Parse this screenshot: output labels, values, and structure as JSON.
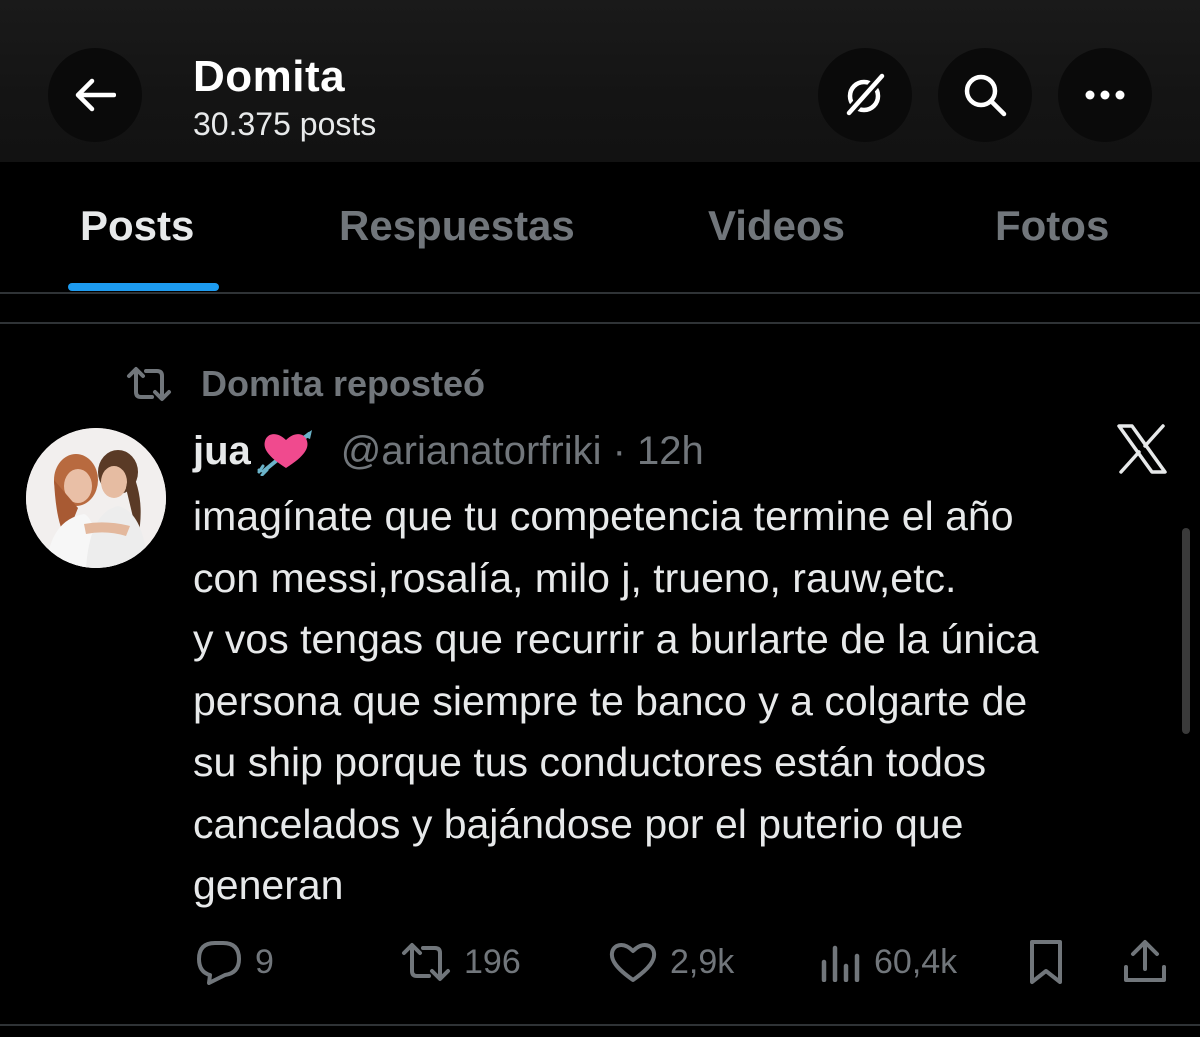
{
  "header": {
    "title": "Domita",
    "subtitle": "30.375 posts",
    "icons": {
      "back": "arrow-left-icon",
      "grok": "grok-icon",
      "search": "search-icon",
      "more": "more-icon"
    }
  },
  "tabs": [
    {
      "label": "Posts",
      "active": true
    },
    {
      "label": "Respuestas",
      "active": false
    },
    {
      "label": "Videos",
      "active": false
    },
    {
      "label": "Fotos",
      "active": false
    }
  ],
  "post": {
    "repost_label": "Domita reposteó",
    "author": {
      "display_name": "jua",
      "emoji": "💘",
      "handle": "@arianatorfriki · 12h"
    },
    "text_lines": [
      "imagínate que tu competencia termine el año",
      "con messi,rosalía, milo j, trueno, rauw,etc.",
      "y vos tengas que recurrir a burlarte de la única",
      "persona que siempre te banco y a colgarte de",
      "su ship porque tus conductores están todos",
      "cancelados y bajándose por el puterio que",
      "generan"
    ],
    "stats": {
      "replies": "9",
      "reposts": "196",
      "likes": "2,9k",
      "views": "60,4k"
    }
  },
  "colors": {
    "accent": "#1d9bf0",
    "text_primary": "#e7e9ea",
    "text_secondary": "#71767b",
    "background": "#000000"
  }
}
